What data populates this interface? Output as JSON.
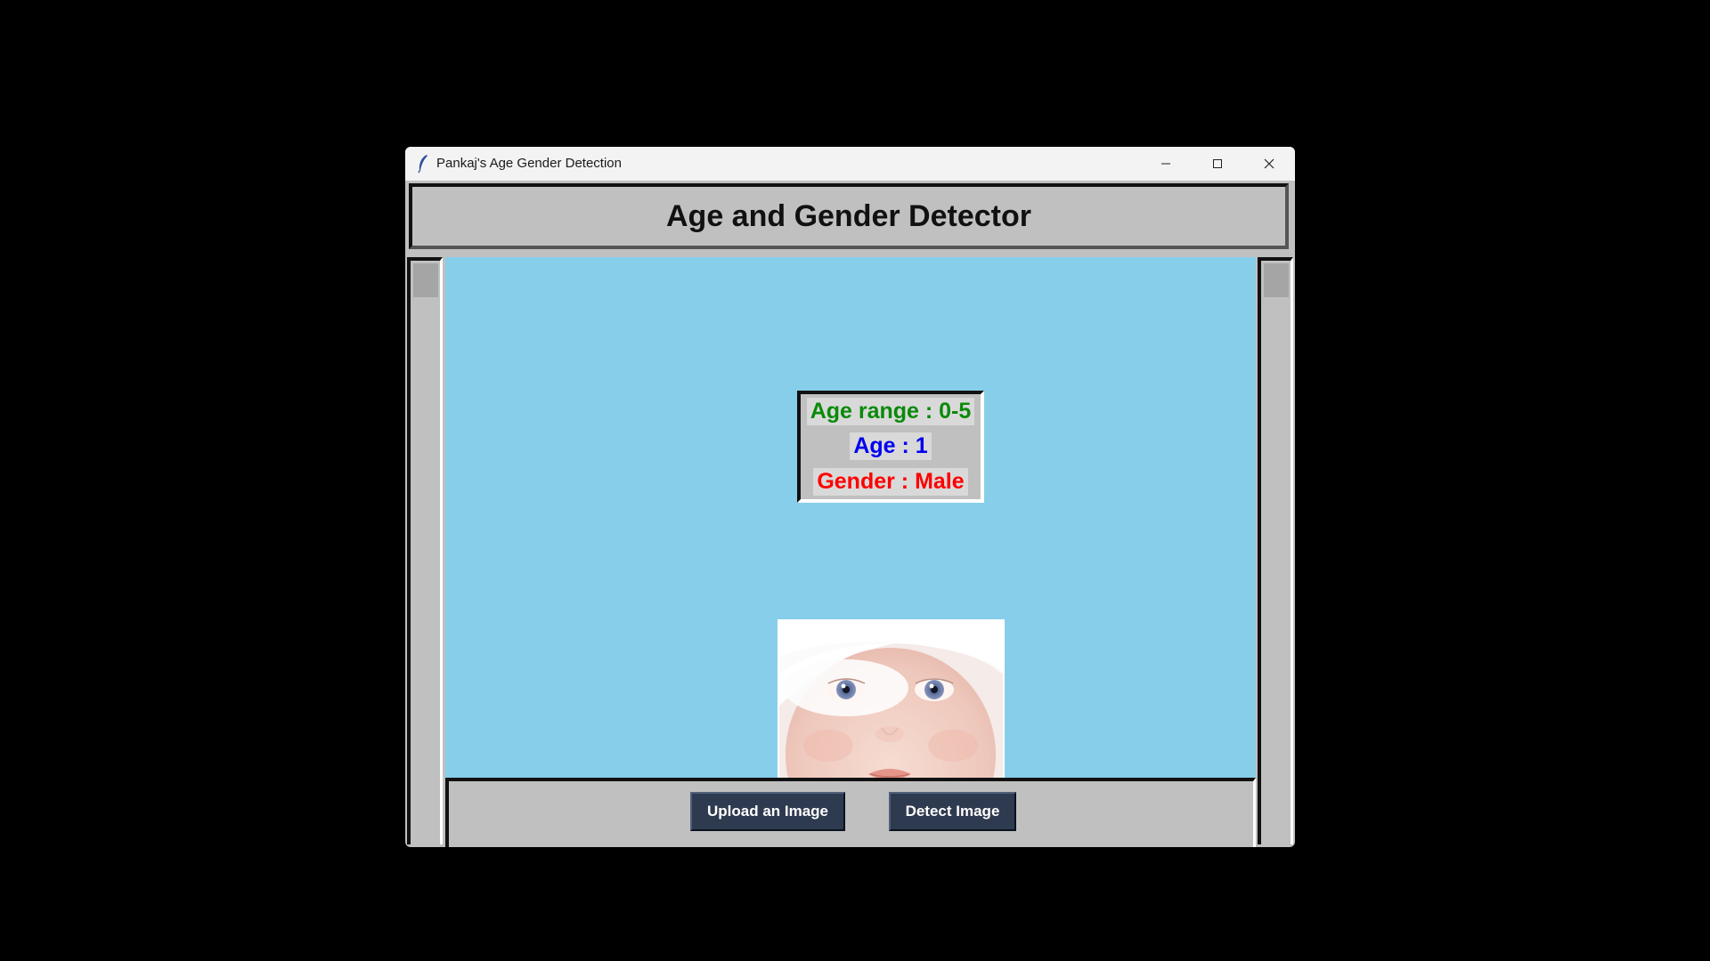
{
  "window": {
    "title": "Pankaj's Age Gender Detection",
    "controls": [
      "minimize-icon",
      "maximize-icon",
      "close-icon"
    ]
  },
  "header": {
    "title": "Age and Gender Detector"
  },
  "result": {
    "age_range": "Age range :  0-5",
    "age": "Age  :  1",
    "gender": "Gender :  Male",
    "colors": {
      "age_range": "#0a8a0a",
      "age": "#0000ee",
      "gender": "#ff0000"
    }
  },
  "canvas": {
    "background": "#87ceeb",
    "image": "baby-face-photo"
  },
  "buttons": {
    "upload_label": "Upload an Image",
    "detect_label": "Detect Image"
  }
}
